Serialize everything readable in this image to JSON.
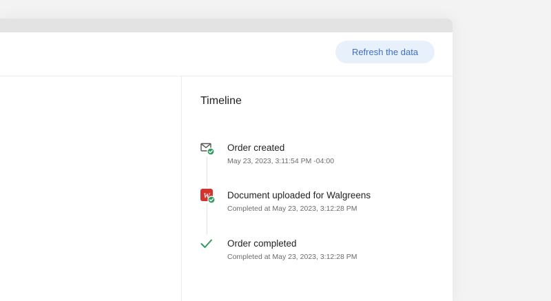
{
  "header": {
    "refresh_button_label": "Refresh the data"
  },
  "timeline": {
    "title": "Timeline",
    "items": [
      {
        "title": "Order created",
        "subtitle": "May 23, 2023, 3:11:54 PM -04:00",
        "icon": "envelope-check-icon"
      },
      {
        "title": "Document uploaded for Walgreens",
        "subtitle": "Completed at May 23, 2023, 3:12:28 PM",
        "icon": "walgreens-logo-icon",
        "logo_text": "W"
      },
      {
        "title": "Order completed",
        "subtitle": "Completed at May 23, 2023, 3:12:28 PM",
        "icon": "checkmark-icon"
      }
    ]
  },
  "colors": {
    "accent_blue": "#3b6fc4",
    "button_bg": "#e8f0fb",
    "success_green": "#2e9b5f",
    "walgreens_red": "#d0342c"
  }
}
